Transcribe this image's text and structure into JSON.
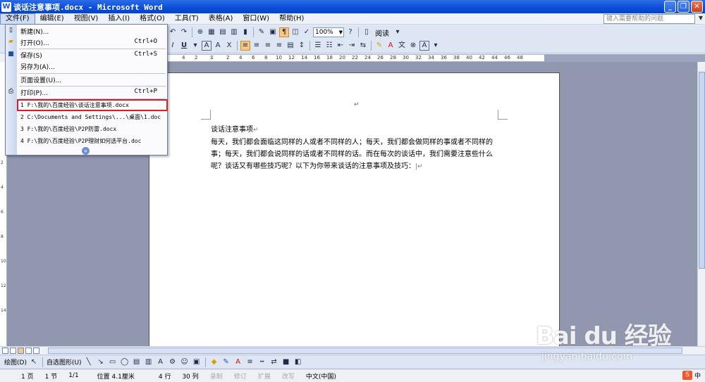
{
  "window": {
    "title": "谈话注意事项.docx - Microsoft Word",
    "icon": "W"
  },
  "menubar": {
    "items": [
      "文件(F)",
      "编辑(E)",
      "视图(V)",
      "插入(I)",
      "格式(O)",
      "工具(T)",
      "表格(A)",
      "窗口(W)",
      "帮助(H)"
    ],
    "help_placeholder": "键入需要帮助的问题"
  },
  "toolbar": {
    "zoom": "100%",
    "read_label": "阅读"
  },
  "ruler": {
    "numbers": [
      "4",
      "2",
      "2",
      "4",
      "6",
      "8",
      "10",
      "12",
      "14",
      "16",
      "18",
      "20",
      "22",
      "24",
      "26",
      "28",
      "30",
      "32",
      "34",
      "36",
      "38",
      "40",
      "42",
      "44",
      "46",
      "48"
    ]
  },
  "file_menu": {
    "items": [
      {
        "label": "新建(N)...",
        "shortcut": ""
      },
      {
        "label": "打开(O)...",
        "shortcut": "Ctrl+O"
      },
      {
        "label": "保存(S)",
        "shortcut": "Ctrl+S"
      },
      {
        "label": "另存为(A)...",
        "shortcut": ""
      },
      {
        "label": "页面设置(U)...",
        "shortcut": ""
      },
      {
        "label": "打印(P)...",
        "shortcut": "Ctrl+P"
      }
    ],
    "recent": [
      "1 F:\\我的\\百度经验\\谈话注意事项.docx",
      "2 C:\\Documents and Settings\\...\\桌面\\1.doc",
      "3 F:\\我的\\百度经验\\P2P防雷.docx",
      "4 F:\\我的\\百度经验\\P2P理财如何选平台.doc"
    ]
  },
  "document": {
    "title": "谈话注意事项",
    "body": "每天，我们都会面临这同样的人或者不同样的人；每天，我们都会做同样的事或者不同样的事；每天，我们都会说同样的话或者不同样的话。而在每次的谈话中，我们需要注意些什么呢？谈话又有哪些技巧呢？以下为你带来谈话的注意事项及技巧："
  },
  "drawing_toolbar": {
    "draw_label": "绘图(D)",
    "autoshape_label": "自选图形(U)"
  },
  "statusbar": {
    "page": "1 页",
    "section": "1 节",
    "pages": "1/1",
    "position": "位置 4.1厘米",
    "line": "4 行",
    "column": "30 列",
    "rec": "录制",
    "trk": "修订",
    "ext": "扩展",
    "ovr": "改写",
    "language": "中文(中国)",
    "ime": "中"
  },
  "watermark": {
    "logo": "Bai du 经验",
    "url": "jingyan.baidu.com"
  }
}
